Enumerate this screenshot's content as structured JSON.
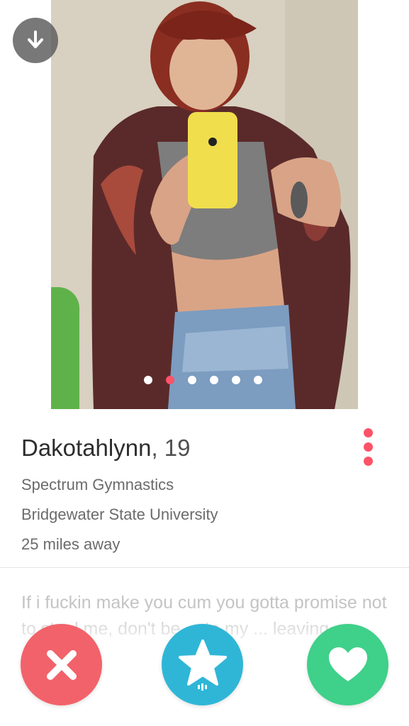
{
  "profile": {
    "name": "Dakotahlynn",
    "age": ", 19",
    "job": "Spectrum Gymnastics",
    "school": "Bridgewater State University",
    "distance": "25 miles away",
    "bio": "If i fuckin make you cum you gotta promise not to steal me, don't be ... to my ... leaving"
  },
  "photo": {
    "count": 6,
    "active_index": 1,
    "icon": "download-icon"
  },
  "actions": {
    "nope_icon": "close-icon",
    "superlike_icon": "star-icon",
    "like_icon": "heart-icon"
  },
  "colors": {
    "accent": "#fe5268",
    "nope": "#f2626a",
    "superlike": "#2fb6d7",
    "like": "#3fd08a"
  }
}
